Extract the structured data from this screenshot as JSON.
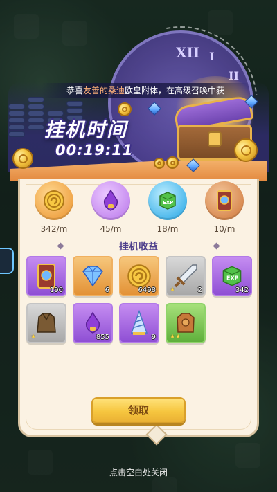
{
  "announcement": {
    "prefix": "恭喜",
    "highlight": "友善的桑迪",
    "suffix": "欧皇附体，在高级召唤中获"
  },
  "title": "挂机时间",
  "timer": "00:19:11",
  "rates": [
    {
      "icon": "gold-coin-icon",
      "value": "342/m",
      "color": "#f5b04d"
    },
    {
      "icon": "purple-potion-icon",
      "value": "45/m",
      "color": "#c78bf0"
    },
    {
      "icon": "exp-cube-icon",
      "value": "18/m",
      "color": "#5cc8f0"
    },
    {
      "icon": "hero-card-icon",
      "value": "10/m",
      "color": "#d9925a"
    }
  ],
  "section_title": "挂机收益",
  "rewards": [
    {
      "icon": "hero-card-icon",
      "qty": "190",
      "rarity": "purple"
    },
    {
      "icon": "diamond-gem-icon",
      "qty": "6",
      "rarity": "orange"
    },
    {
      "icon": "gold-coin-icon",
      "qty": "6498",
      "rarity": "orange"
    },
    {
      "icon": "sword-icon",
      "qty": "2",
      "rarity": "gray",
      "stars": "★"
    },
    {
      "icon": "exp-cube-icon",
      "qty": "342",
      "rarity": "purple"
    },
    {
      "icon": "leather-armor-icon",
      "qty": "",
      "rarity": "gray",
      "stars": "★"
    },
    {
      "icon": "purple-potion-icon",
      "qty": "855",
      "rarity": "purple"
    },
    {
      "icon": "spiral-horn-icon",
      "qty": "9",
      "rarity": "purple"
    },
    {
      "icon": "bronze-armor-icon",
      "qty": "",
      "rarity": "green",
      "stars": "★★"
    }
  ],
  "claim_label": "领取",
  "close_hint": "点击空白处关闭",
  "clock_numerals": [
    "XII",
    "I",
    "II"
  ]
}
